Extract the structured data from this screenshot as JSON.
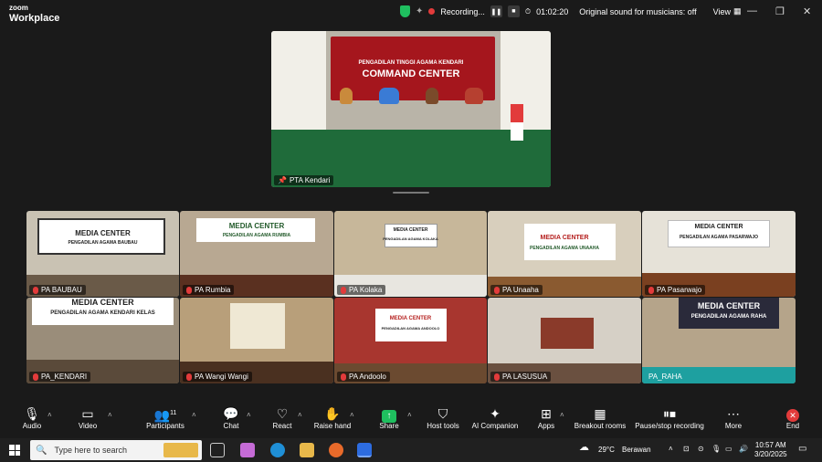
{
  "app": {
    "brand_top": "zoom",
    "brand_bottom": "Workplace"
  },
  "titlebar": {
    "recording_label": "Recording...",
    "timer": "01:02:20",
    "audio_mode": "Original sound for musicians: off",
    "view_label": "View"
  },
  "speaker": {
    "name": "PTA Kendari",
    "banner_small": "PENGADILAN TINGGI AGAMA KENDARI",
    "banner_big": "COMMAND CENTER"
  },
  "participants": [
    {
      "name": "PA BAUBAU",
      "banner": "MEDIA CENTER",
      "sub": "PENGADILAN AGAMA BAUBAU"
    },
    {
      "name": "PA Rumbia",
      "banner": "MEDIA CENTER",
      "sub": "PENGADILAN AGAMA RUMBIA"
    },
    {
      "name": "PA Kolaka",
      "banner": "MEDIA CENTER",
      "sub": "PENGADILAN AGAMA KOLAKA"
    },
    {
      "name": "PA Unaaha",
      "banner": "MEDIA CENTER",
      "sub": "PENGADILAN AGAMA UNAAHA"
    },
    {
      "name": "PA Pasarwajo",
      "banner": "MEDIA CENTER",
      "sub": "PENGADILAN AGAMA PASARWAJO"
    },
    {
      "name": "PA_KENDARI",
      "banner": "MEDIA CENTER",
      "sub": "PENGADILAN AGAMA KENDARI KELAS"
    },
    {
      "name": "PA Wangi Wangi",
      "banner": "",
      "sub": ""
    },
    {
      "name": "PA Andoolo",
      "banner": "MEDIA CENTER",
      "sub": "PENGADILAN AGAMA ANDOOLO"
    },
    {
      "name": "PA LASUSUA",
      "banner": "",
      "sub": ""
    },
    {
      "name": "PA_RAHA",
      "banner": "MEDIA CENTER",
      "sub": "PENGADILAN AGAMA RAHA"
    }
  ],
  "toolbar": {
    "audio": "Audio",
    "video": "Video",
    "participants": "Participants",
    "participants_count": "11",
    "chat": "Chat",
    "react": "React",
    "raise_hand": "Raise hand",
    "share": "Share",
    "host_tools": "Host tools",
    "ai_companion": "AI Companion",
    "apps": "Apps",
    "breakout": "Breakout rooms",
    "pause_recording": "Pause/stop recording",
    "more": "More",
    "end": "End"
  },
  "taskbar": {
    "search_placeholder": "Type here to search",
    "weather_temp": "29°C",
    "weather_desc": "Berawan",
    "time": "10:57 AM",
    "date": "3/20/2025"
  },
  "colors": {
    "accent_green": "#1fbf5f",
    "record_red": "#e23b3b",
    "share_green": "#1fbf5f",
    "end_red": "#e23b3b"
  }
}
